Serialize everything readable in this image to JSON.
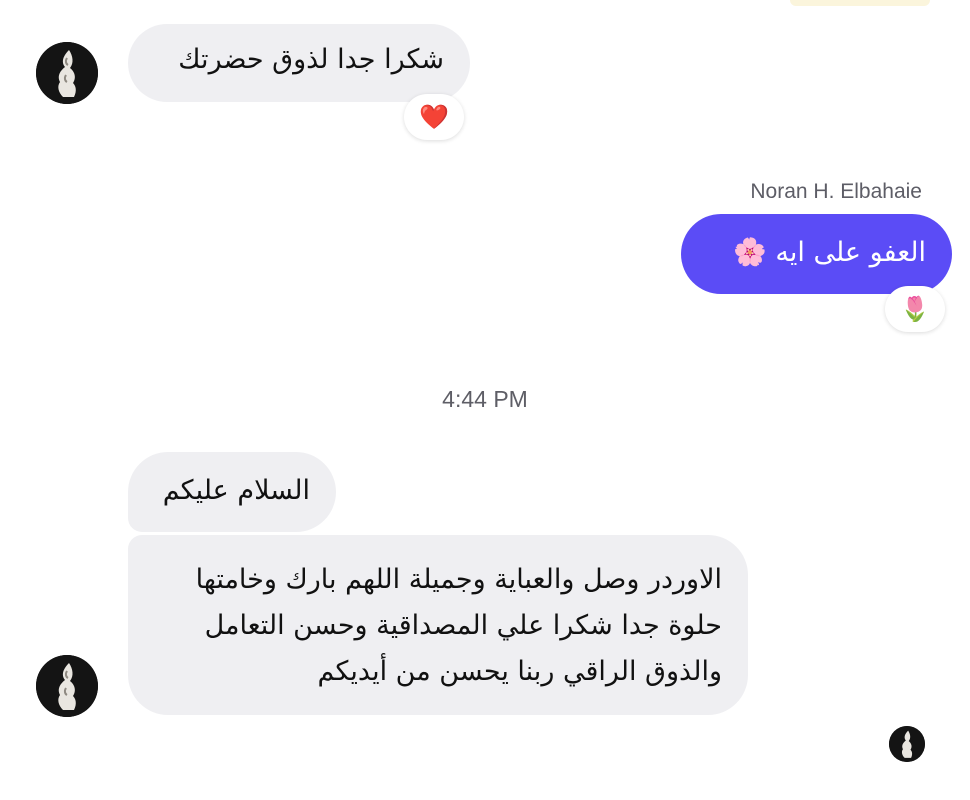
{
  "conversation": {
    "msg1": {
      "text": "شكرا جدا لذوق حضرتك",
      "reaction": "❤️"
    },
    "msg2": {
      "sender": "Noran H. Elbahaie",
      "text": "العفو على ايه 🌸",
      "reaction": "🌷"
    },
    "timestamp": "4:44 PM",
    "msg3": {
      "text": "السلام عليكم"
    },
    "msg4": {
      "lines": [
        "الاوردر وصل والعباية وجميلة اللهم بارك وخامتها",
        "حلوة جدا شكرا علي المصداقية وحسن التعامل",
        "والذوق الراقي ربنا يحسن من أيديكم"
      ]
    }
  },
  "colors": {
    "outgoing_bubble": "#5b4cf6",
    "incoming_bubble": "#efeff2"
  },
  "icons": {
    "contact_avatar": "avatar-figure-icon",
    "read_receipt": "seen-avatar-icon"
  }
}
